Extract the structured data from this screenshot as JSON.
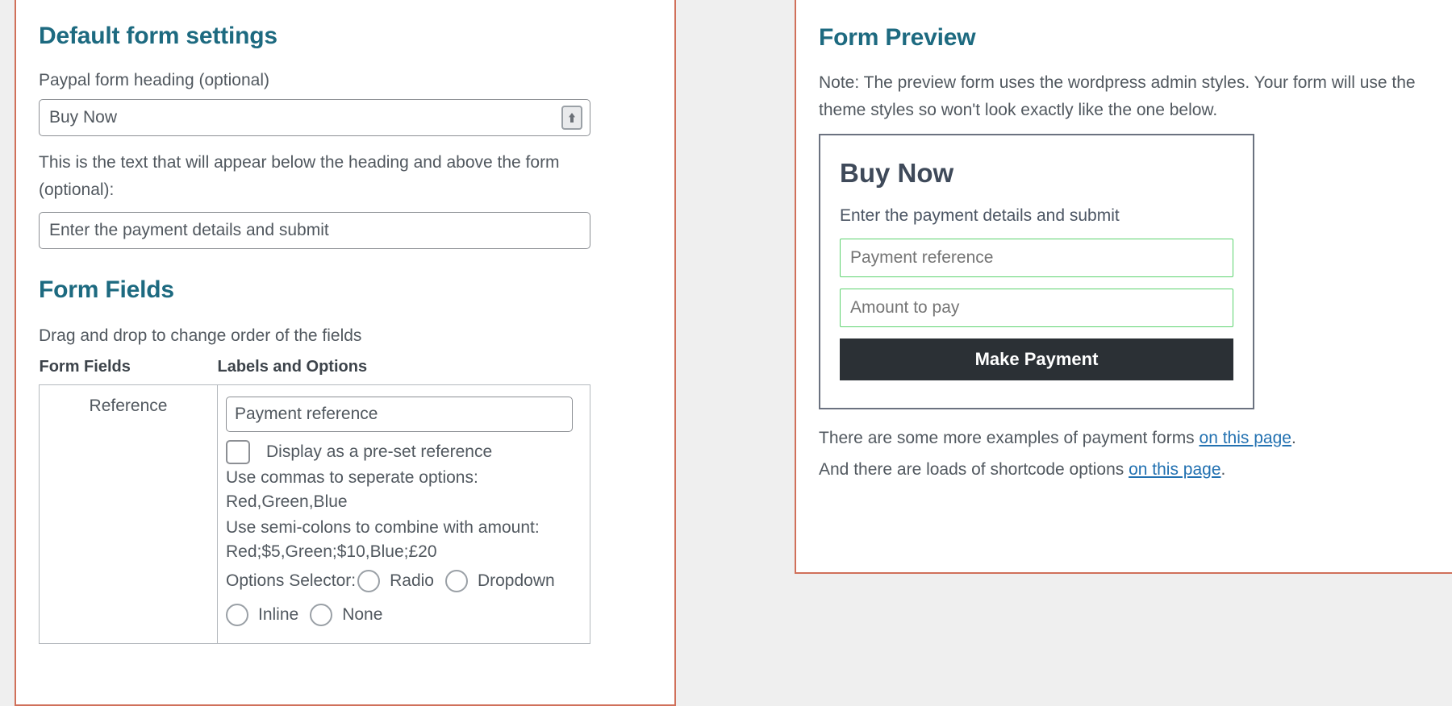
{
  "theme": {
    "panel_border": "#d0705a",
    "heading_color": "#1d6a80",
    "page_background": "#efefef",
    "preview_input_border": "#5dd36f",
    "pay_button_background": "#2b3035",
    "link_color": "#2271b1"
  },
  "left_panel": {
    "title": "Default form settings",
    "heading_field": {
      "label": "Paypal form heading (optional)",
      "value": "Buy Now",
      "icon": "autofill-icon"
    },
    "description_field": {
      "label": "This is the text that will appear below the heading and above the form (optional):",
      "value": "Enter the payment details and submit"
    },
    "form_fields": {
      "title": "Form Fields",
      "drag_hint": "Drag and drop to change order of the fields",
      "columns": [
        "Form Fields",
        "Labels and Options"
      ],
      "rows": [
        {
          "field_name": "Reference",
          "label_value": "Payment reference",
          "checkbox_label": "Display as a pre-set reference",
          "checkbox_checked": false,
          "hints": [
            "Use commas to seperate options: Red,Green,Blue",
            "Use semi-colons to combine with amount: Red;$5,Green;$10,Blue;£20"
          ],
          "selector_label": "Options Selector:",
          "selector_options": [
            "Radio",
            "Dropdown",
            "Inline",
            "None"
          ],
          "selector_selected": ""
        }
      ]
    }
  },
  "right_panel": {
    "title": "Form Preview",
    "note": "Note: The preview form uses the wordpress admin styles. Your form will use the theme styles so won't look exactly like the one below.",
    "preview": {
      "heading": "Buy Now",
      "subtext": "Enter the payment details and submit",
      "inputs": [
        {
          "placeholder": "Payment reference"
        },
        {
          "placeholder": "Amount to pay"
        }
      ],
      "submit_label": "Make Payment"
    },
    "footer": [
      {
        "before": "There are some more examples of payment forms ",
        "link": "on this page",
        "after": "."
      },
      {
        "before": "And there are loads of shortcode options ",
        "link": "on this page",
        "after": "."
      }
    ]
  }
}
